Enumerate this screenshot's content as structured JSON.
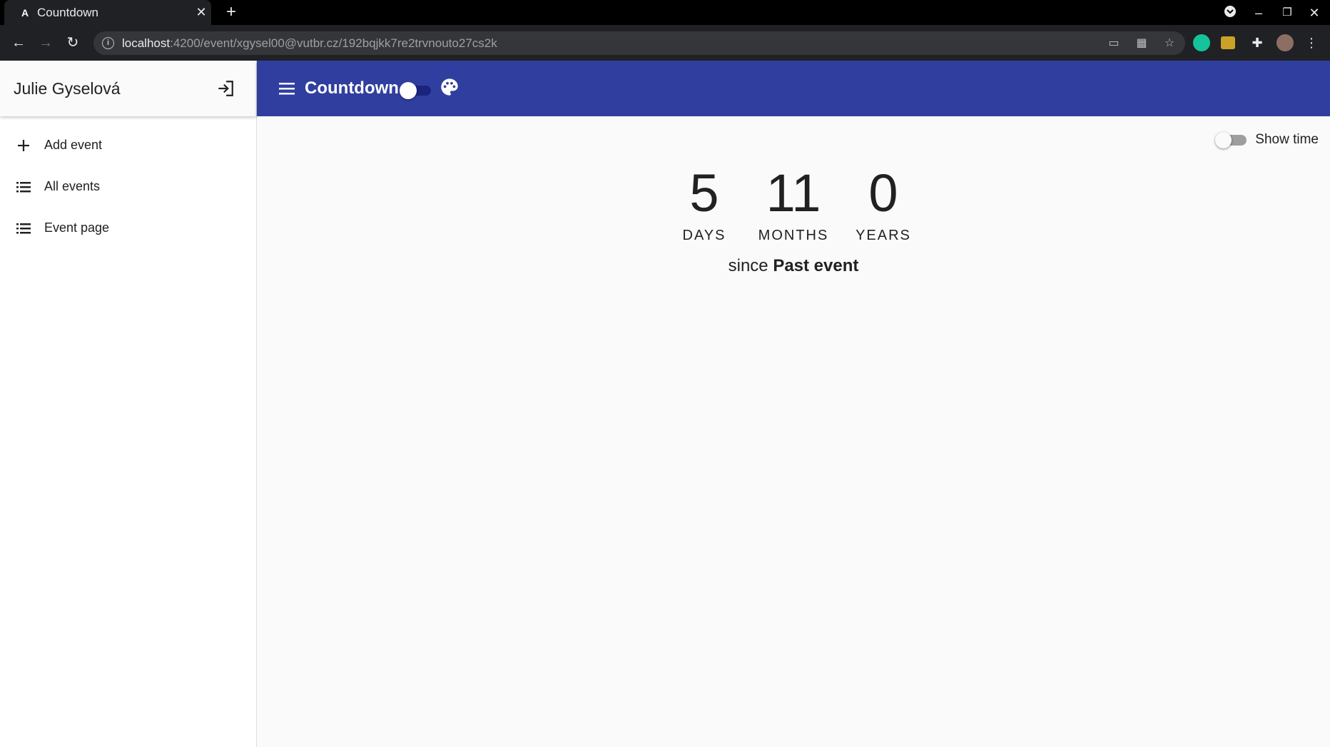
{
  "browser": {
    "tab_title": "Countdown",
    "favicon_letter": "A",
    "url_host": "localhost",
    "url_path": ":4200/event/xgysel00@vutbr.cz/192bqjkk7re2trvnouto27cs2k"
  },
  "sidenav": {
    "user_name": "Julie Gyselová",
    "items": [
      {
        "label": "Add event",
        "icon": "plus-icon"
      },
      {
        "label": "All events",
        "icon": "list-icon"
      },
      {
        "label": "Event page",
        "icon": "list-icon"
      }
    ]
  },
  "appbar": {
    "title": "Countdown",
    "color": "#303f9f"
  },
  "content": {
    "show_time_label": "Show time",
    "counters": [
      {
        "value": "5",
        "unit": "DAYS"
      },
      {
        "value": "11",
        "unit": "MONTHS"
      },
      {
        "value": "0",
        "unit": "YEARS"
      }
    ],
    "since_prefix": "since",
    "event_name": "Past event"
  }
}
